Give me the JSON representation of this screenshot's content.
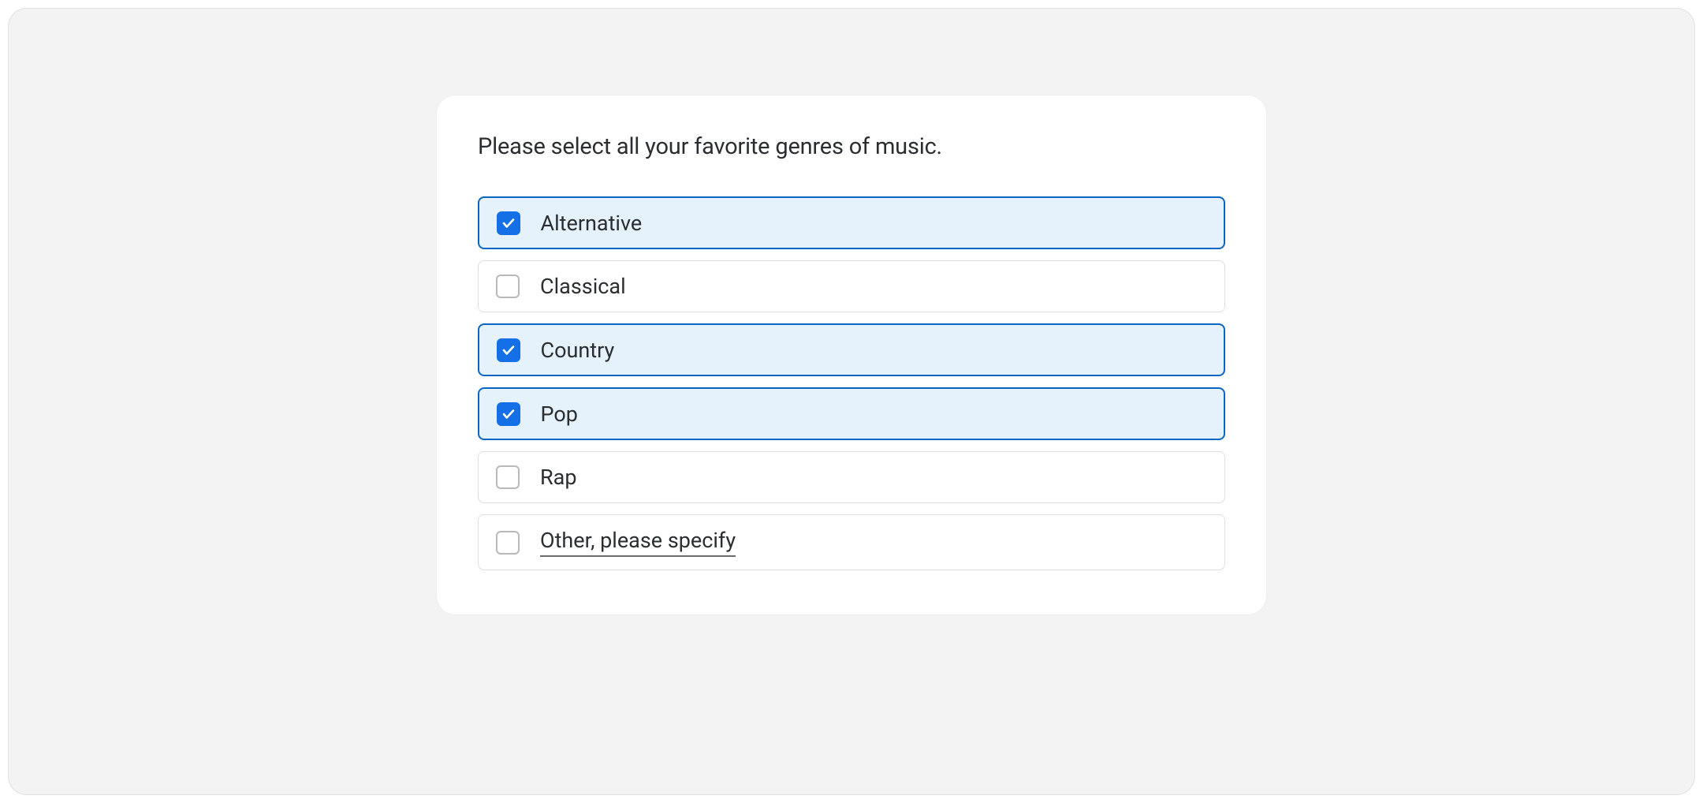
{
  "question": {
    "title": "Please select all your favorite genres of music.",
    "options": [
      {
        "label": "Alternative",
        "checked": true,
        "other": false
      },
      {
        "label": "Classical",
        "checked": false,
        "other": false
      },
      {
        "label": "Country",
        "checked": true,
        "other": false
      },
      {
        "label": "Pop",
        "checked": true,
        "other": false
      },
      {
        "label": "Rap",
        "checked": false,
        "other": false
      },
      {
        "label": "Other, please specify",
        "checked": false,
        "other": true
      }
    ]
  },
  "colors": {
    "accent": "#156fe6",
    "selected_border": "#0a66c2",
    "selected_bg": "#e6f2fb",
    "card_bg": "#ffffff",
    "page_bg": "#f3f3f3"
  }
}
